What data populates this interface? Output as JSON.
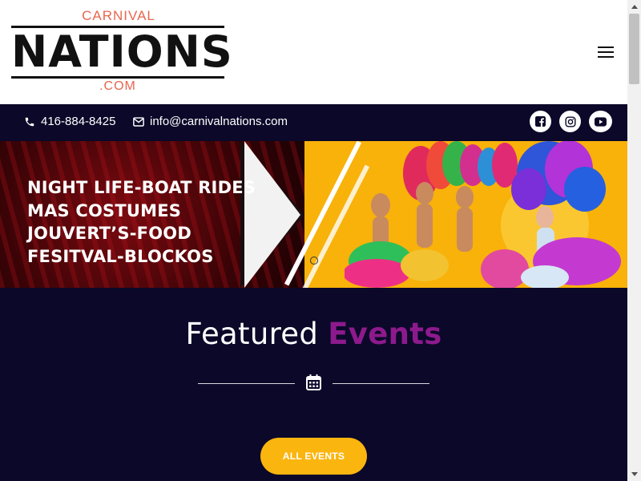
{
  "logo": {
    "top": "CARNIVAL",
    "main": "NATIONS",
    "bottom": ".COM"
  },
  "contact": {
    "phone": "416-884-8425",
    "email": "info@carnivalnations.com"
  },
  "social": [
    "facebook-icon",
    "instagram-icon",
    "youtube-icon"
  ],
  "banner": {
    "lines": [
      "NIGHT LIFE-BOAT RIDES",
      "MAS COSTUMES",
      "JOUVERT’S-FOOD",
      "FESITVAL-BLOCKOS"
    ]
  },
  "featured": {
    "title_white": "Featured",
    "title_accent": "Events",
    "button_label": "ALL EVENTS"
  },
  "colors": {
    "navy": "#0b0829",
    "accent_purple": "#8d1a8c",
    "yellow": "#fbb50f",
    "logo_coral": "#e8664f"
  }
}
